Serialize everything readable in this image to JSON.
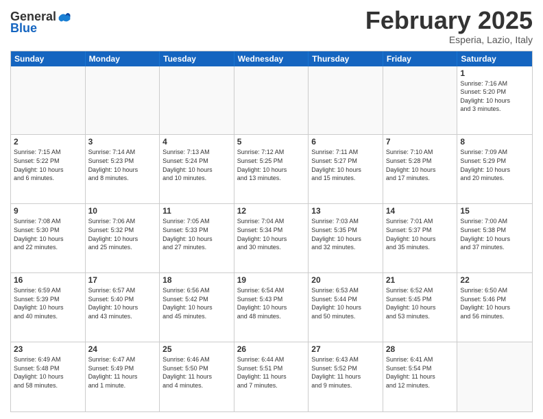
{
  "logo": {
    "general": "General",
    "blue": "Blue"
  },
  "title": "February 2025",
  "location": "Esperia, Lazio, Italy",
  "days": [
    "Sunday",
    "Monday",
    "Tuesday",
    "Wednesday",
    "Thursday",
    "Friday",
    "Saturday"
  ],
  "weeks": [
    [
      {
        "day": "",
        "text": ""
      },
      {
        "day": "",
        "text": ""
      },
      {
        "day": "",
        "text": ""
      },
      {
        "day": "",
        "text": ""
      },
      {
        "day": "",
        "text": ""
      },
      {
        "day": "",
        "text": ""
      },
      {
        "day": "1",
        "text": "Sunrise: 7:16 AM\nSunset: 5:20 PM\nDaylight: 10 hours\nand 3 minutes."
      }
    ],
    [
      {
        "day": "2",
        "text": "Sunrise: 7:15 AM\nSunset: 5:22 PM\nDaylight: 10 hours\nand 6 minutes."
      },
      {
        "day": "3",
        "text": "Sunrise: 7:14 AM\nSunset: 5:23 PM\nDaylight: 10 hours\nand 8 minutes."
      },
      {
        "day": "4",
        "text": "Sunrise: 7:13 AM\nSunset: 5:24 PM\nDaylight: 10 hours\nand 10 minutes."
      },
      {
        "day": "5",
        "text": "Sunrise: 7:12 AM\nSunset: 5:25 PM\nDaylight: 10 hours\nand 13 minutes."
      },
      {
        "day": "6",
        "text": "Sunrise: 7:11 AM\nSunset: 5:27 PM\nDaylight: 10 hours\nand 15 minutes."
      },
      {
        "day": "7",
        "text": "Sunrise: 7:10 AM\nSunset: 5:28 PM\nDaylight: 10 hours\nand 17 minutes."
      },
      {
        "day": "8",
        "text": "Sunrise: 7:09 AM\nSunset: 5:29 PM\nDaylight: 10 hours\nand 20 minutes."
      }
    ],
    [
      {
        "day": "9",
        "text": "Sunrise: 7:08 AM\nSunset: 5:30 PM\nDaylight: 10 hours\nand 22 minutes."
      },
      {
        "day": "10",
        "text": "Sunrise: 7:06 AM\nSunset: 5:32 PM\nDaylight: 10 hours\nand 25 minutes."
      },
      {
        "day": "11",
        "text": "Sunrise: 7:05 AM\nSunset: 5:33 PM\nDaylight: 10 hours\nand 27 minutes."
      },
      {
        "day": "12",
        "text": "Sunrise: 7:04 AM\nSunset: 5:34 PM\nDaylight: 10 hours\nand 30 minutes."
      },
      {
        "day": "13",
        "text": "Sunrise: 7:03 AM\nSunset: 5:35 PM\nDaylight: 10 hours\nand 32 minutes."
      },
      {
        "day": "14",
        "text": "Sunrise: 7:01 AM\nSunset: 5:37 PM\nDaylight: 10 hours\nand 35 minutes."
      },
      {
        "day": "15",
        "text": "Sunrise: 7:00 AM\nSunset: 5:38 PM\nDaylight: 10 hours\nand 37 minutes."
      }
    ],
    [
      {
        "day": "16",
        "text": "Sunrise: 6:59 AM\nSunset: 5:39 PM\nDaylight: 10 hours\nand 40 minutes."
      },
      {
        "day": "17",
        "text": "Sunrise: 6:57 AM\nSunset: 5:40 PM\nDaylight: 10 hours\nand 43 minutes."
      },
      {
        "day": "18",
        "text": "Sunrise: 6:56 AM\nSunset: 5:42 PM\nDaylight: 10 hours\nand 45 minutes."
      },
      {
        "day": "19",
        "text": "Sunrise: 6:54 AM\nSunset: 5:43 PM\nDaylight: 10 hours\nand 48 minutes."
      },
      {
        "day": "20",
        "text": "Sunrise: 6:53 AM\nSunset: 5:44 PM\nDaylight: 10 hours\nand 50 minutes."
      },
      {
        "day": "21",
        "text": "Sunrise: 6:52 AM\nSunset: 5:45 PM\nDaylight: 10 hours\nand 53 minutes."
      },
      {
        "day": "22",
        "text": "Sunrise: 6:50 AM\nSunset: 5:46 PM\nDaylight: 10 hours\nand 56 minutes."
      }
    ],
    [
      {
        "day": "23",
        "text": "Sunrise: 6:49 AM\nSunset: 5:48 PM\nDaylight: 10 hours\nand 58 minutes."
      },
      {
        "day": "24",
        "text": "Sunrise: 6:47 AM\nSunset: 5:49 PM\nDaylight: 11 hours\nand 1 minute."
      },
      {
        "day": "25",
        "text": "Sunrise: 6:46 AM\nSunset: 5:50 PM\nDaylight: 11 hours\nand 4 minutes."
      },
      {
        "day": "26",
        "text": "Sunrise: 6:44 AM\nSunset: 5:51 PM\nDaylight: 11 hours\nand 7 minutes."
      },
      {
        "day": "27",
        "text": "Sunrise: 6:43 AM\nSunset: 5:52 PM\nDaylight: 11 hours\nand 9 minutes."
      },
      {
        "day": "28",
        "text": "Sunrise: 6:41 AM\nSunset: 5:54 PM\nDaylight: 11 hours\nand 12 minutes."
      },
      {
        "day": "",
        "text": ""
      }
    ]
  ]
}
